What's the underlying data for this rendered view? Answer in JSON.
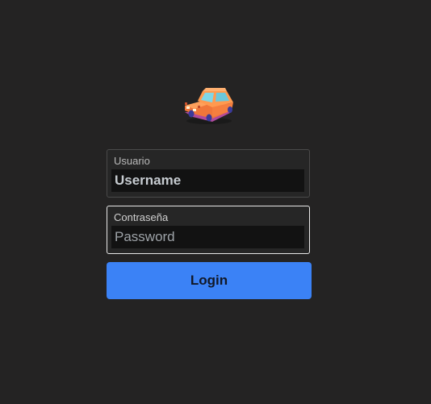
{
  "app": {
    "logo_icon": "car-icon"
  },
  "login_form": {
    "username": {
      "label": "Usuario",
      "value": "Username",
      "placeholder": "Username"
    },
    "password": {
      "label": "Contraseña",
      "value": "",
      "placeholder": "Password"
    },
    "submit_label": "Login"
  },
  "colors": {
    "background": "#242323",
    "accent": "#3b82f6",
    "input_background": "#121212"
  }
}
